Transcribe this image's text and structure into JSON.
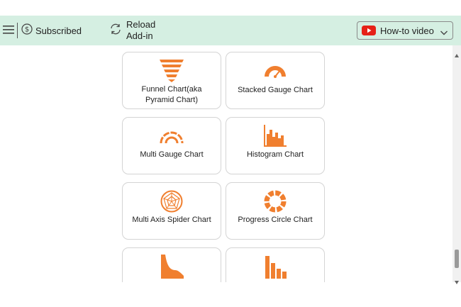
{
  "toolbar": {
    "menu_icon": "hamburger-icon",
    "subscription": {
      "icon": "dollar-circle-icon",
      "label": "Subscribed"
    },
    "reload": {
      "icon": "refresh-icon",
      "line1": "Reload",
      "line2": "Add-in"
    },
    "howto": {
      "icon": "youtube-icon",
      "label": "How-to video",
      "icon_color": "#e62117"
    }
  },
  "accent_color": "#f07f2f",
  "cards": [
    {
      "label": "Funnel Chart(aka Pyramid Chart)",
      "icon": "funnel-chart-icon"
    },
    {
      "label": "Stacked Gauge Chart",
      "icon": "stacked-gauge-icon"
    },
    {
      "label": "Multi Gauge Chart",
      "icon": "multi-gauge-icon"
    },
    {
      "label": "Histogram Chart",
      "icon": "histogram-icon"
    },
    {
      "label": "Multi Axis Spider Chart",
      "icon": "spider-chart-icon"
    },
    {
      "label": "Progress Circle Chart",
      "icon": "progress-circle-icon"
    },
    {
      "label": "",
      "icon": "area-chart-icon"
    },
    {
      "label": "",
      "icon": "bar-chart-icon"
    }
  ]
}
